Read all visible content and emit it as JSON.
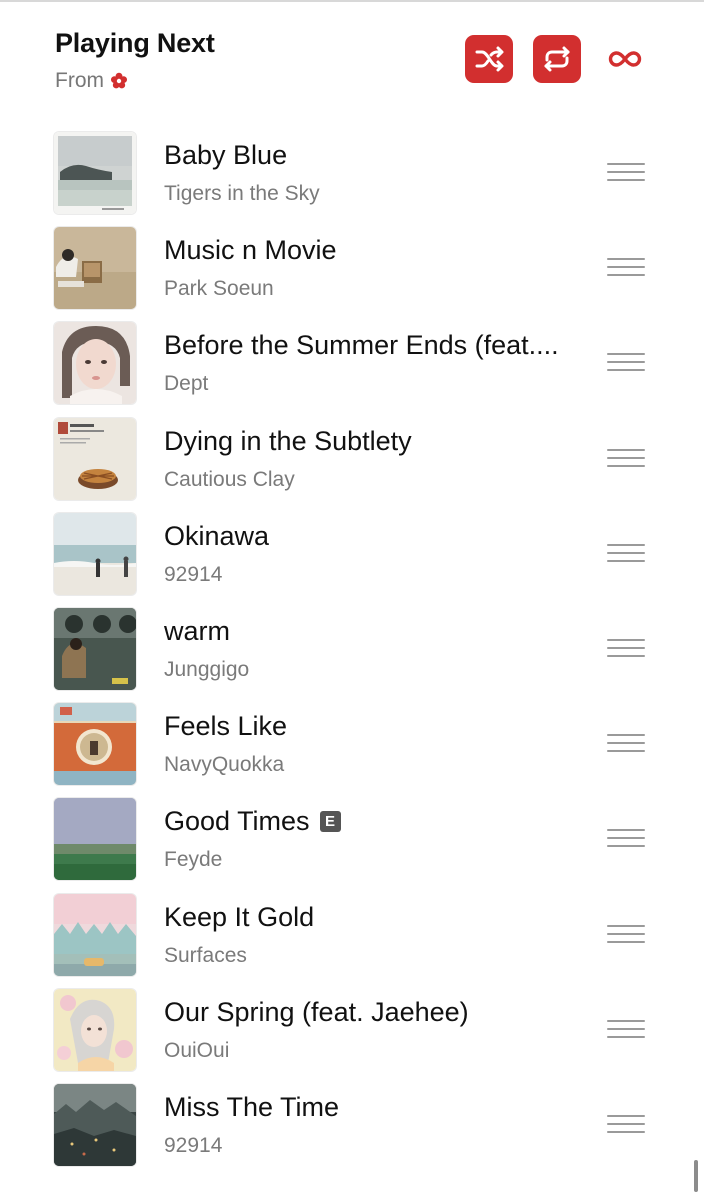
{
  "header": {
    "title": "Playing Next",
    "from_label": "From",
    "accent_color": "#d22f2f"
  },
  "controls": {
    "shuffle_icon": "shuffle-icon",
    "repeat_icon": "repeat-icon",
    "autoplay_icon": "infinity-icon"
  },
  "queue": [
    {
      "title": "Baby Blue",
      "artist": "Tigers in the Sky",
      "explicit": false
    },
    {
      "title": "Music n Movie",
      "artist": "Park Soeun",
      "explicit": false
    },
    {
      "title": "Before the Summer Ends (feat....",
      "artist": "Dept",
      "explicit": false
    },
    {
      "title": "Dying in the Subtlety",
      "artist": "Cautious Clay",
      "explicit": false
    },
    {
      "title": "Okinawa",
      "artist": "92914",
      "explicit": false
    },
    {
      "title": "warm",
      "artist": "Junggigo",
      "explicit": false
    },
    {
      "title": "Feels Like",
      "artist": "NavyQuokka",
      "explicit": false
    },
    {
      "title": "Good Times",
      "artist": "Feyde",
      "explicit": true,
      "explicit_badge": "E"
    },
    {
      "title": "Keep It Gold",
      "artist": "Surfaces",
      "explicit": false
    },
    {
      "title": "Our Spring (feat. Jaehee)",
      "artist": "OuiOui",
      "explicit": false
    },
    {
      "title": "Miss The Time",
      "artist": "92914",
      "explicit": false
    }
  ]
}
